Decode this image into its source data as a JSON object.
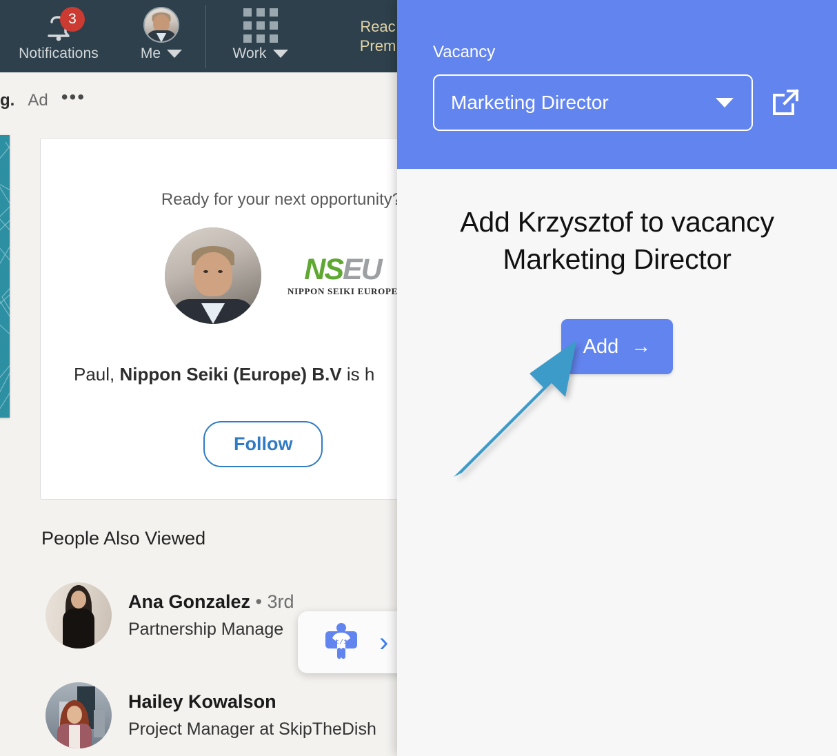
{
  "colors": {
    "panel_accent": "#6284EE",
    "nav_background": "#2D404B",
    "badge_red": "#CC3B32",
    "follow_blue": "#2F7CC4",
    "annotation_arrow": "#3D9BC9",
    "panel_background": "#F7F7F7",
    "feed_background": "#F3F2EF",
    "teal_card": "#2C8FA2"
  },
  "linkedin": {
    "nav": {
      "notifications": {
        "label": "Notifications",
        "badge_count": "3",
        "icon": "bell-icon"
      },
      "me": {
        "label": "Me",
        "icon": "avatar",
        "caret": "chevron-down-icon"
      },
      "work": {
        "label": "Work",
        "icon": "grid-icon",
        "caret": "chevron-down-icon"
      },
      "promo": {
        "line1": "Reac",
        "line2": "Prem"
      }
    },
    "feed_meta": {
      "post_fragment": "g.",
      "ad_label": "Ad",
      "more_icon": "ellipsis-icon"
    },
    "ad_card": {
      "headline": "Ready for your next opportunity?",
      "logo_mark_green": "NS",
      "logo_mark_gray": "EU",
      "logo_subtitle": "NIPPON SEIKI EUROPE",
      "body_prefix": "Paul, ",
      "body_bold": "Nippon Seiki (Europe) B.V",
      "body_suffix": " is h",
      "follow_label": "Follow"
    },
    "people_also_viewed": {
      "title": "People Also Viewed",
      "items": [
        {
          "name": "Ana Gonzalez",
          "degree": "• 3rd",
          "subtitle": "Partnership Manage"
        },
        {
          "name": "Hailey Kowalson",
          "degree": "",
          "subtitle": "Project Manager at SkipTheDish"
        }
      ]
    },
    "widget": {
      "icon": "person-code-icon",
      "chevron": "chevron-right-icon",
      "chevron_glyph": "›"
    }
  },
  "panel": {
    "header": {
      "vacancy_label": "Vacancy",
      "vacancy_selected": "Marketing Director",
      "vacancy_caret_icon": "chevron-down-icon",
      "open_external_icon": "external-link-icon"
    },
    "title": "Add Krzysztof to vacancy Marketing Director",
    "add_button": {
      "label": "Add",
      "icon": "arrow-right-icon",
      "glyph": "→"
    },
    "annotation": {
      "type": "arrow-annotation",
      "direction": "up-right",
      "points_to": "add-button"
    }
  }
}
